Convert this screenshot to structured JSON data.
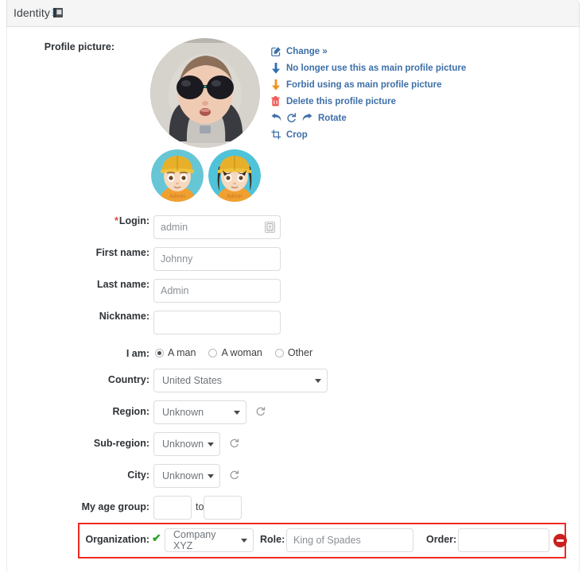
{
  "tab": {
    "title": "Identity",
    "icon": "address-book-icon"
  },
  "profile_picture": {
    "label": "Profile picture:",
    "main_alt": "baby wearing sunglasses in grey hooded jacket",
    "thumbnails": [
      {
        "caption": "Admin",
        "alt": "cartoon avatar with yellow cap"
      },
      {
        "caption": "Admin",
        "alt": "cartoon avatar with yellow cap and long hair"
      }
    ],
    "actions": [
      {
        "icon": "edit-square-icon",
        "label": "Change »",
        "color": "#3d6fa8"
      },
      {
        "icon": "arrow-down-icon",
        "label": "No longer use this as main profile picture",
        "color": "#2f6fb5"
      },
      {
        "icon": "arrow-down-orange-icon",
        "label": "Forbid using as main profile picture",
        "color": "#f0921e"
      },
      {
        "icon": "trash-icon",
        "label": "Delete this profile picture",
        "color": "#ef5350"
      },
      {
        "icon": "rotate-icons",
        "label": "Rotate",
        "color": "#3d6fa8"
      },
      {
        "icon": "crop-icon",
        "label": "Crop",
        "color": "#3d6fa8"
      }
    ]
  },
  "fields": {
    "login": {
      "label": "Login:",
      "required": true,
      "value": "admin",
      "trailing_icon": "id-card-icon"
    },
    "first_name": {
      "label": "First name:",
      "value": "Johnny"
    },
    "last_name": {
      "label": "Last name:",
      "value": "Admin"
    },
    "nickname": {
      "label": "Nickname:",
      "value": ""
    },
    "gender": {
      "label": "I am:",
      "options": [
        {
          "label": "A man",
          "selected": true
        },
        {
          "label": "A woman",
          "selected": false
        },
        {
          "label": "Other",
          "selected": false
        }
      ]
    },
    "country": {
      "label": "Country:",
      "value": "United States"
    },
    "region": {
      "label": "Region:",
      "value": "Unknown",
      "refresh_icon": "refresh-icon"
    },
    "sub_region": {
      "label": "Sub-region:",
      "value": "Unknown",
      "refresh_icon": "refresh-icon"
    },
    "city": {
      "label": "City:",
      "value": "Unknown",
      "refresh_icon": "refresh-icon"
    },
    "age_group": {
      "label": "My age group:",
      "from": "",
      "to_label": "to",
      "to": ""
    }
  },
  "organization_row": {
    "label": "Organization:",
    "status_icon": "green-check-icon",
    "organization": "Company XYZ",
    "role_label": "Role:",
    "role": "King of Spades",
    "order_label": "Order:",
    "order": "",
    "remove_icon": "remove-circle-icon",
    "highlight_color": "#ee2a23"
  }
}
